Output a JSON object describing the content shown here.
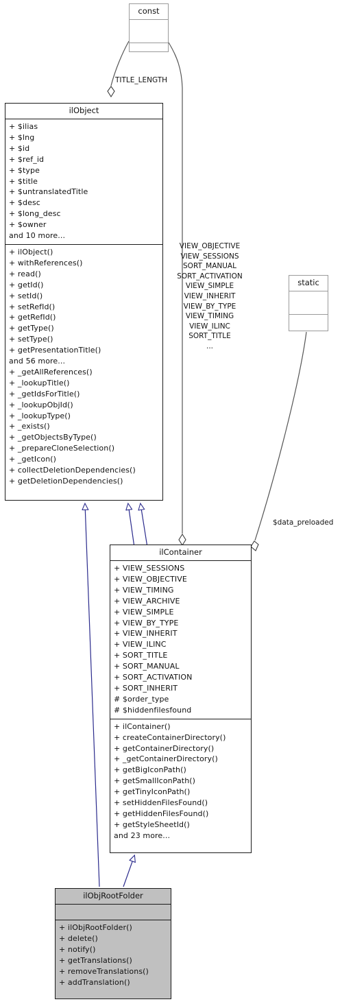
{
  "diagram": {
    "type": "uml-class-diagram",
    "colors": {
      "inheritance_arrow": "#2a2a8c",
      "aggregation_line": "#555555",
      "box_border_strong": "#1a1a1a",
      "box_border_light": "#9a9a9a",
      "box_fill_highlight": "#c0c0c0",
      "background": "#ffffff"
    },
    "classes": [
      {
        "id": "const",
        "name": "const",
        "style": "light",
        "attributes": [],
        "operations": []
      },
      {
        "id": "ilObject",
        "name": "ilObject",
        "style": "strong",
        "attributes": [
          "+ $ilias",
          "+ $lng",
          "+ $id",
          "+ $ref_id",
          "+ $type",
          "+ $title",
          "+ $untranslatedTitle",
          "+ $desc",
          "+ $long_desc",
          "+ $owner",
          "and 10 more..."
        ],
        "operations": [
          "+ ilObject()",
          "+ withReferences()",
          "+ read()",
          "+ getId()",
          "+ setId()",
          "+ setRefId()",
          "+ getRefId()",
          "+ getType()",
          "+ setType()",
          "+ getPresentationTitle()",
          "and 56 more...",
          "+ _getAllReferences()",
          "+ _lookupTitle()",
          "+ _getIdsForTitle()",
          "+ _lookupObjId()",
          "+ _lookupType()",
          "+ _exists()",
          "+ _getObjectsByType()",
          "+ _prepareCloneSelection()",
          "+ _getIcon()",
          "+ collectDeletionDependencies()",
          "+ getDeletionDependencies()"
        ]
      },
      {
        "id": "static",
        "name": "static",
        "style": "light",
        "attributes": [],
        "operations": []
      },
      {
        "id": "ilContainer",
        "name": "ilContainer",
        "style": "strong",
        "attributes": [
          "+ VIEW_SESSIONS",
          "+ VIEW_OBJECTIVE",
          "+ VIEW_TIMING",
          "+ VIEW_ARCHIVE",
          "+ VIEW_SIMPLE",
          "+ VIEW_BY_TYPE",
          "+ VIEW_INHERIT",
          "+ VIEW_ILINC",
          "+ SORT_TITLE",
          "+ SORT_MANUAL",
          "+ SORT_ACTIVATION",
          "+ SORT_INHERIT",
          "# $order_type",
          "# $hiddenfilesfound"
        ],
        "operations": [
          "+ ilContainer()",
          "+ createContainerDirectory()",
          "+ getContainerDirectory()",
          "+ _getContainerDirectory()",
          "+ getBigIconPath()",
          "+ getSmallIconPath()",
          "+ getTinyIconPath()",
          "+ setHiddenFilesFound()",
          "+ getHiddenFilesFound()",
          "+ getStyleSheetId()",
          "and 23 more..."
        ]
      },
      {
        "id": "ilObjRootFolder",
        "name": "ilObjRootFolder",
        "style": "strong-filled",
        "attributes": [],
        "operations": [
          "+ ilObjRootFolder()",
          "+ delete()",
          "+ notify()",
          "+ getTranslations()",
          "+ removeTranslations()",
          "+ addTranslation()"
        ]
      }
    ],
    "edge_labels": {
      "title_length": "TITLE_LENGTH",
      "const_to_container": [
        "VIEW_OBJECTIVE",
        "VIEW_SESSIONS",
        "SORT_MANUAL",
        "SORT_ACTIVATION",
        "VIEW_SIMPLE",
        "VIEW_INHERIT",
        "VIEW_BY_TYPE",
        "VIEW_TIMING",
        "VIEW_ILINC",
        "SORT_TITLE",
        "..."
      ],
      "data_preloaded": "$data_preloaded"
    },
    "relationships": [
      {
        "from": "const",
        "to": "ilObject",
        "type": "aggregation",
        "label": "TITLE_LENGTH"
      },
      {
        "from": "const",
        "to": "ilContainer",
        "type": "aggregation",
        "label": "VIEW_OBJECTIVE VIEW_SESSIONS SORT_MANUAL SORT_ACTIVATION VIEW_SIMPLE VIEW_INHERIT VIEW_BY_TYPE VIEW_TIMING VIEW_ILINC SORT_TITLE ..."
      },
      {
        "from": "static",
        "to": "ilContainer",
        "type": "aggregation",
        "label": "$data_preloaded"
      },
      {
        "from": "ilContainer",
        "to": "ilObject",
        "type": "inheritance"
      },
      {
        "from": "ilObjRootFolder",
        "to": "ilObject",
        "type": "inheritance"
      },
      {
        "from": "ilObjRootFolder",
        "to": "ilContainer",
        "type": "inheritance"
      }
    ]
  }
}
